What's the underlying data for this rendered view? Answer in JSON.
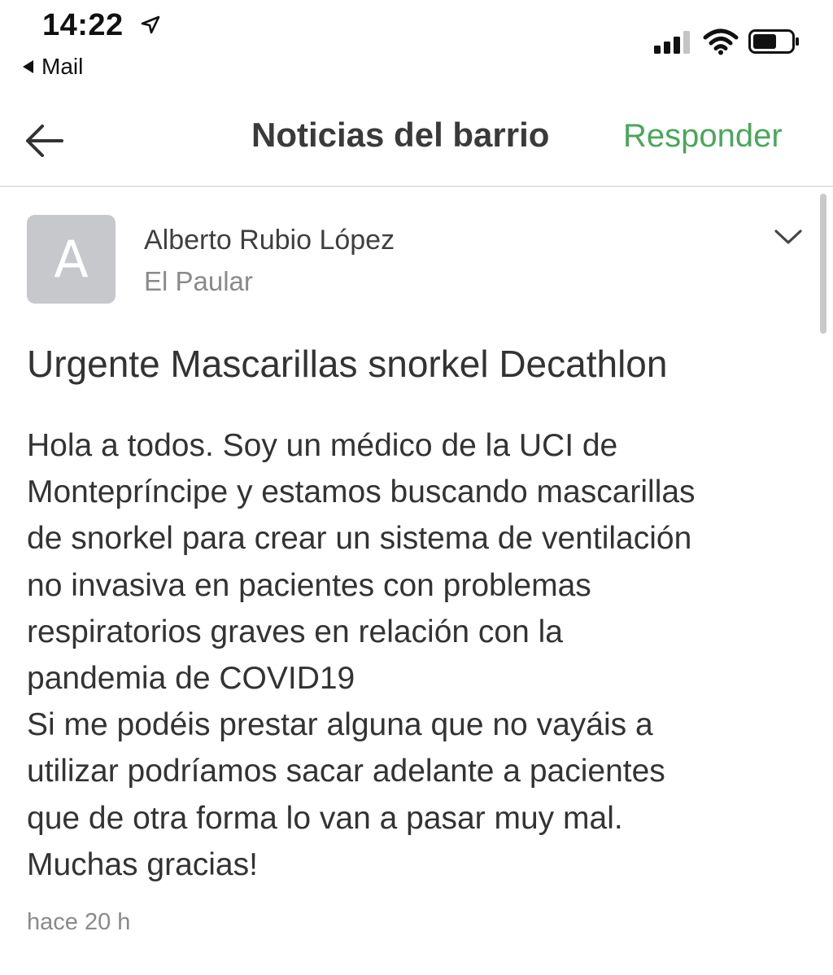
{
  "status_bar": {
    "time": "14:22",
    "location_icon": "location-arrow-icon",
    "back_app_label": "Mail",
    "signal_icon": "cellular-signal-icon",
    "wifi_icon": "wifi-icon",
    "battery_icon": "battery-icon"
  },
  "nav": {
    "back_icon": "arrow-left-icon",
    "title": "Noticias del barrio",
    "reply_label": "Responder",
    "accent_color": "#4aa75a"
  },
  "post": {
    "author": {
      "avatar_letter": "A",
      "name": "Alberto Rubio López",
      "location": "El Paular"
    },
    "more_icon": "chevron-down-icon",
    "title": "Urgente Mascarillas snorkel Decathlon",
    "body_lines": [
      "Hola a todos. Soy un médico de la UCI de",
      "Montepríncipe y estamos buscando mascarillas",
      "de snorkel para crear un sistema de ventilación",
      "no invasiva en pacientes con problemas",
      "respiratorios graves en relación con la",
      "pandemia de COVID19",
      "Si me podéis prestar alguna que no vayáis a",
      "utilizar podríamos sacar adelante a pacientes",
      "que de otra forma lo van a pasar muy mal.",
      "Muchas gracias!"
    ],
    "timestamp": "hace 20 h"
  }
}
